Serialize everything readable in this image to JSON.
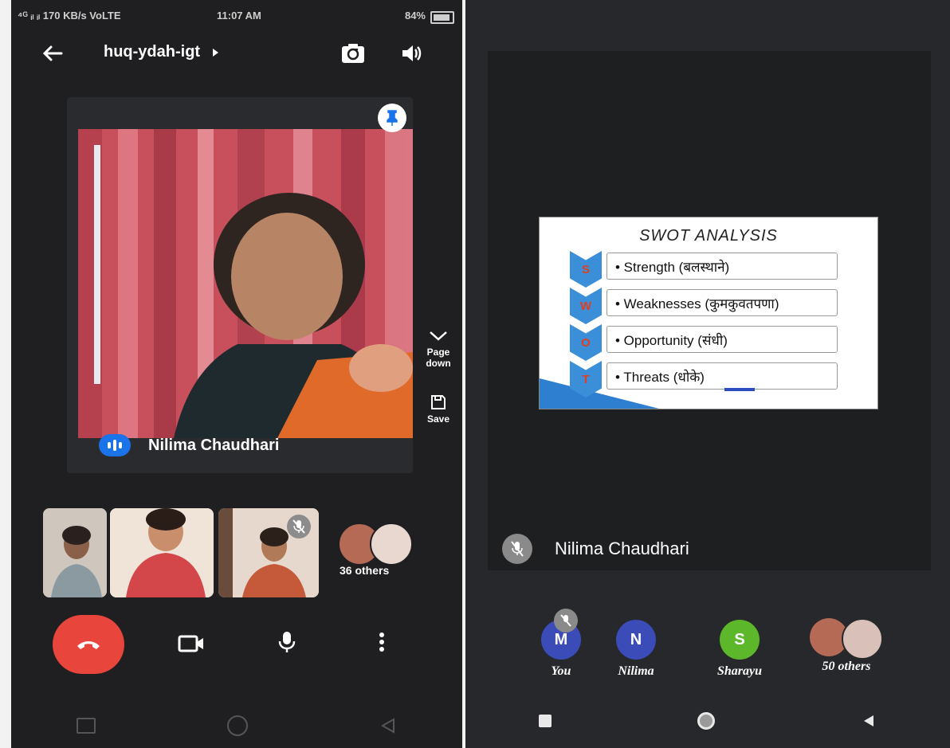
{
  "left_screen": {
    "status": {
      "network": "⁴ᴳ ᵢₗ ᵢₗ 170 KB/s VoLTE",
      "time": "11:07 AM",
      "battery": "84%"
    },
    "meeting_code": "huq-ydah-igt",
    "main_speaker": "Nilima Chaudhari",
    "side_actions": {
      "page_down_label": "Page down",
      "save_label": "Save"
    },
    "others_count": "36 others"
  },
  "right_screen": {
    "presentation": {
      "title": "SWOT ANALYSIS",
      "items": [
        {
          "letter": "S",
          "text": "• Strength (बलस्थाने)"
        },
        {
          "letter": "W",
          "text": "• Weaknesses (कुमकुवतपणा)"
        },
        {
          "letter": "O",
          "text": "• Opportunity (संधी)"
        },
        {
          "letter": "T",
          "text": "• Threats (धोके)"
        }
      ]
    },
    "presenter_name": "Nilima Chaudhari",
    "participants": [
      {
        "initial": "M",
        "label": "You",
        "color": "#3b4cb8"
      },
      {
        "initial": "N",
        "label": "Nilima",
        "color": "#3b4cb8"
      },
      {
        "initial": "S",
        "label": "Sharayu",
        "color": "#5cb82a"
      }
    ],
    "others_count": "50 others"
  },
  "colors": {
    "end_call": "#e8453c",
    "speaking": "#1a73e8"
  }
}
